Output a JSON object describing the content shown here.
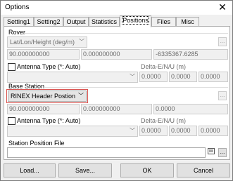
{
  "window": {
    "title": "Options",
    "close_label": "✕"
  },
  "tabs": [
    {
      "label": "Setting1"
    },
    {
      "label": "Setting2"
    },
    {
      "label": "Output"
    },
    {
      "label": "Statistics"
    },
    {
      "label": "Positions",
      "active": true
    },
    {
      "label": "Files"
    },
    {
      "label": "Misc"
    }
  ],
  "rover": {
    "heading": "Rover",
    "position_type": "Lat/Lon/Height (deg/m)",
    "coord1": "90.000000000",
    "coord2": "0.000000000",
    "coord3": "-6335367.6285",
    "antenna_label": "Antenna Type (*: Auto)",
    "delta_label": "Delta-E/N/U (m)",
    "antenna_value": "",
    "delta_e": "0.0000",
    "delta_n": "0.0000",
    "delta_u": "0.0000",
    "ellipsis": "..."
  },
  "base": {
    "heading": "Base Station",
    "position_type": "RINEX Header Postion",
    "coord1": "90.000000000",
    "coord2": "0.000000000",
    "coord3": "0.0000",
    "antenna_label": "Antenna Type (*: Auto)",
    "delta_label": "Delta-E/N/U (m)",
    "antenna_value": "",
    "delta_e": "0.0000",
    "delta_n": "0.0000",
    "delta_u": "0.0000",
    "ellipsis": "..."
  },
  "station": {
    "label": "Station Position File",
    "value": "",
    "ellipsis": "..."
  },
  "buttons": {
    "load": "Load...",
    "save": "Save...",
    "ok": "OK",
    "cancel": "Cancel"
  }
}
